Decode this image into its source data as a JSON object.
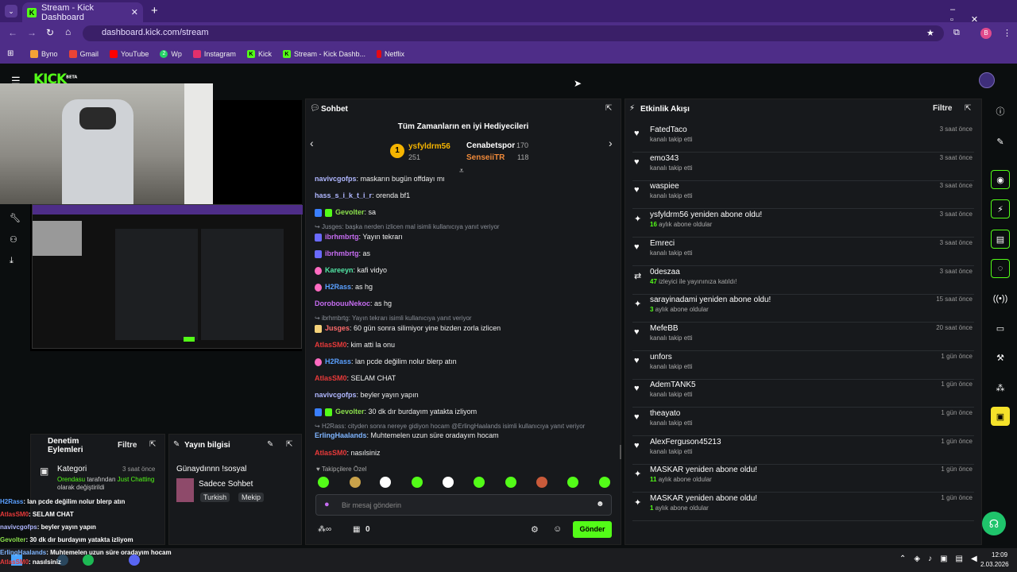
{
  "browser": {
    "tab_title": "Stream - Kick Dashboard",
    "url": "dashboard.kick.com/stream",
    "bookmarks": [
      "Byno",
      "Gmail",
      "YouTube",
      "Wp",
      "Instagram",
      "Kick",
      "Stream - Kick Dashb...",
      "Netflix"
    ],
    "bookmark_wp_badge": "2",
    "profile_initial": "B"
  },
  "header": {
    "logo": "KICK",
    "beta": "BETA"
  },
  "mod": {
    "title": "Denetim Eylemleri",
    "filter": "Filtre",
    "category_label": "Kategori",
    "time": "3 saat önce",
    "user": "Orendasu",
    "text1": " tarafından ",
    "cat": "Just Chatting",
    "text2": " olarak değiştirildi"
  },
  "streaminfo": {
    "title": "Yayın bilgisi",
    "stream_title": "Günaydınnn !sosyal",
    "category": "Sadece Sohbet",
    "tags": [
      "Turkish",
      "Mekip"
    ]
  },
  "chat": {
    "title": "Sohbet",
    "gifters_title": "Tüm Zamanların en iyi Hediyecileri",
    "gifters": [
      {
        "rank": "1",
        "name": "ysfyldrm56",
        "count": "251"
      },
      {
        "name": "Cenabetspor",
        "count": "170"
      },
      {
        "name": "SenseiiTR",
        "count": "118"
      }
    ],
    "messages": [
      {
        "user": "navivcgofps",
        "text": "maskarın bugün offdayı mı",
        "color": "#b0b7ff"
      },
      {
        "user": "hass_s_i_k_t_i_r",
        "text": "orenda bf1",
        "color": "#b0b7ff"
      },
      {
        "user": "Gevolter",
        "text": "sa",
        "color": "#8be04c"
      },
      {
        "reply": "Jusges: başka nerden izlicen mal isimli kullanıcıya yanıt veriyor",
        "user": "ibrhmbrtg",
        "text": "Yayın tekrarı",
        "color": "#c56cf0"
      },
      {
        "user": "ibrhmbrtg",
        "text": "as",
        "color": "#c56cf0"
      },
      {
        "user": "Kareeyn",
        "text": "kafi vidyo",
        "color": "#52e6a5"
      },
      {
        "user": "H2Rass",
        "text": "as hg",
        "color": "#5aa0ff"
      },
      {
        "user": "DorobouuNekoc",
        "text": "as hg",
        "color": "#c56cf0"
      },
      {
        "reply": "ibrhmbrtg: Yayın tekrarı isimli kullanıcıya yanıt veriyor",
        "user": "Jusges",
        "text": "60 gün sonra silimiyor yine bizden zorla izlicen",
        "color": "#ff6b6b"
      },
      {
        "user": "AtlasSM0",
        "text": "kim atti la onu",
        "color": "#e83a3a"
      },
      {
        "user": "H2Rass",
        "text": "lan pcde değilim nolur blerp atın",
        "color": "#5aa0ff"
      },
      {
        "user": "AtlasSM0",
        "text": "SELAM CHAT",
        "color": "#e83a3a"
      },
      {
        "user": "navivcgofps",
        "text": "beyler yayın yapın",
        "color": "#b0b7ff"
      },
      {
        "user": "Gevolter",
        "text": "30 dk dır burdayım yatakta izliyom",
        "color": "#8be04c"
      },
      {
        "reply": "H2Rass: cityden sonra nereye gidiyon hocam @ErlingHaalands isimli kullanıcıya yanıt veriyor",
        "user": "ErlingHaalands",
        "text": "Muhtemelen uzun süre oradayım hocam",
        "color": "#7fb5ff"
      },
      {
        "user": "AtlasSM0",
        "text": "nasılsiniz",
        "color": "#e83a3a"
      }
    ],
    "followers_only": "Takipçilere Özel",
    "input_placeholder": "Bir mesaj gönderin",
    "points": "0",
    "send": "Gönder"
  },
  "events": {
    "title": "Etkinlik Akışı",
    "filter": "Filtre",
    "items": [
      {
        "name": "FatedTaco",
        "sub": "kanalı takip etti",
        "time": "3 saat önce",
        "icon": "heart"
      },
      {
        "name": "emo343",
        "sub": "kanalı takip etti",
        "time": "3 saat önce",
        "icon": "heart"
      },
      {
        "name": "waspiee",
        "sub": "kanalı takip etti",
        "time": "3 saat önce",
        "icon": "heart"
      },
      {
        "name": "ysfyldrm56 yeniden abone oldu!",
        "num": "16",
        "sub": " aylık abone oldular",
        "time": "3 saat önce",
        "icon": "sparkle"
      },
      {
        "name": "Emreci",
        "sub": "kanalı takip etti",
        "time": "3 saat önce",
        "icon": "heart"
      },
      {
        "name": "0deszaa",
        "num": "47",
        "sub": " izleyici ile yayınınıza katıldı!",
        "time": "3 saat önce",
        "icon": "raid"
      },
      {
        "name": "sarayinadami yeniden abone oldu!",
        "num": "3",
        "sub": " aylık abone oldular",
        "time": "15 saat önce",
        "icon": "sparkle"
      },
      {
        "name": "MefeBB",
        "sub": "kanalı takip etti",
        "time": "20 saat önce",
        "icon": "heart"
      },
      {
        "name": "unfors",
        "sub": "kanalı takip etti",
        "time": "1 gün önce",
        "icon": "heart"
      },
      {
        "name": "AdemTANK5",
        "sub": "kanalı takip etti",
        "time": "1 gün önce",
        "icon": "heart"
      },
      {
        "name": "theayato",
        "sub": "kanalı takip etti",
        "time": "1 gün önce",
        "icon": "heart"
      },
      {
        "name": "AlexFerguson45213",
        "sub": "kanalı takip etti",
        "time": "1 gün önce",
        "icon": "heart"
      },
      {
        "name": "MASKAR yeniden abone oldu!",
        "num": "11",
        "sub": " aylık abone oldular",
        "time": "1 gün önce",
        "icon": "sparkle"
      },
      {
        "name": "MASKAR yeniden abone oldu!",
        "num": "1",
        "sub": " aylık abone oldular",
        "time": "1 gün önce",
        "icon": "sparkle"
      }
    ]
  },
  "overlay_chat": [
    {
      "user": "H2Rass",
      "text": ": lan pcde değilim nolur blerp atın",
      "color": "#5aa0ff"
    },
    {
      "user": "AtlasSM0",
      "text": ": SELAM CHAT",
      "color": "#e83a3a"
    },
    {
      "user": "navivcgofps",
      "text": ": beyler yayın yapın",
      "color": "#b0b7ff"
    },
    {
      "user": "Gevolter",
      "text": ": 30 dk dır burdayım yatakta izliyom",
      "color": "#8be04c"
    },
    {
      "user": "ErlingHaalands",
      "text": ": Muhtemelen uzun süre oradayım hocam",
      "color": "#7fb5ff"
    },
    {
      "user": "AtlasSM0",
      "text": ": nasılsiniz",
      "color": "#e83a3a"
    }
  ],
  "taskbar": {
    "time": "12:09",
    "date": "2.03.2026"
  },
  "colors": {
    "accent": "#53fc18",
    "tab_purple": "#4e2d88"
  }
}
